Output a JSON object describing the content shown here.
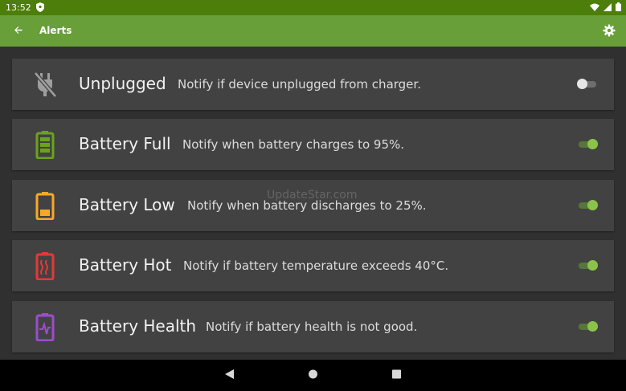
{
  "status": {
    "time": "13:52"
  },
  "appbar": {
    "title": "Alerts"
  },
  "alerts": [
    {
      "title": "Unplugged",
      "desc": "Notify if device unplugged from charger.",
      "enabled": false,
      "color": "#9e9e9e",
      "icon": "unplugged-icon"
    },
    {
      "title": "Battery Full",
      "desc": "Notify when battery charges to 95%.",
      "enabled": true,
      "color": "#6aa31c",
      "icon": "battery-full-icon"
    },
    {
      "title": "Battery Low",
      "desc": "Notify when battery discharges to 25%.",
      "enabled": true,
      "color": "#f9a825",
      "icon": "battery-low-icon"
    },
    {
      "title": "Battery Hot",
      "desc": "Notify if battery temperature exceeds 40°C.",
      "enabled": true,
      "color": "#e53935",
      "icon": "battery-hot-icon"
    },
    {
      "title": "Battery Health",
      "desc": "Notify if battery health is not good.",
      "enabled": true,
      "color": "#9c4dcc",
      "icon": "battery-health-icon"
    }
  ],
  "watermark": "UpdateStar.com",
  "colors": {
    "status_bar": "#4d7d0b",
    "app_bar": "#689f38",
    "accent": "#8bc34a"
  }
}
